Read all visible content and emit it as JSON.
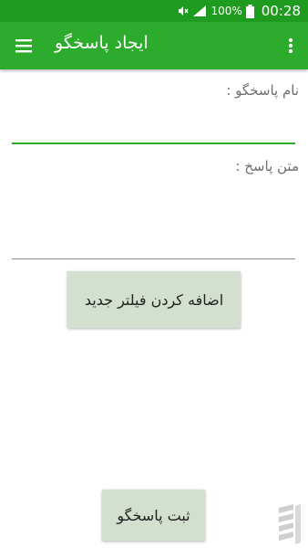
{
  "status_bar": {
    "battery_percent": "100%",
    "time": "00:28",
    "icons": [
      "mute-icon",
      "signal-icon",
      "battery-icon"
    ]
  },
  "app_bar": {
    "title": "ایجاد پاسخگو",
    "menu_icon": "hamburger-menu-icon",
    "overflow_icon": "more-vert-icon"
  },
  "form": {
    "name_label": "نام پاسخگو :",
    "name_value": "",
    "text_label": "متن پاسخ :",
    "text_value": ""
  },
  "buttons": {
    "add_filter": "اضافه کردن فیلتر جدید",
    "save": "ثبت پاسخگو"
  },
  "colors": {
    "status_bar": "#1f9c1f",
    "app_bar": "#2cab2c",
    "accent": "#2cab2c",
    "button_bg": "#d3e0cf"
  }
}
